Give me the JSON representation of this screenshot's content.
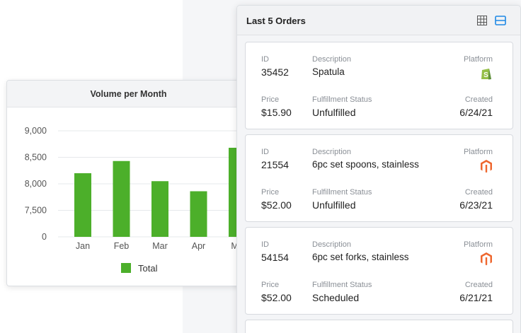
{
  "chart": {
    "title": "Volume per Month",
    "legend_label": "Total",
    "bar_color": "#4caf2a"
  },
  "chart_data": {
    "type": "bar",
    "title": "Volume per Month",
    "categories": [
      "Jan",
      "Feb",
      "Mar",
      "Apr",
      "Ma"
    ],
    "series": [
      {
        "name": "Total",
        "values": [
          8200,
          8430,
          8050,
          7860,
          8680
        ]
      }
    ],
    "yticks": [
      "9,000",
      "8,500",
      "8,000",
      "7,500",
      "0"
    ],
    "ylim": [
      7000,
      9000
    ],
    "legend_position": "bottom",
    "grid": true
  },
  "orders": {
    "title": "Last 5 Orders",
    "labels": {
      "id": "ID",
      "description": "Description",
      "platform": "Platform",
      "price": "Price",
      "fulfillment": "Fulfillment Status",
      "created": "Created"
    },
    "items": [
      {
        "id": "35452",
        "description": "Spatula",
        "platform_icon": "shopify-icon",
        "price": "$15.90",
        "fulfillment": "Unfulfilled",
        "created": "6/24/21"
      },
      {
        "id": "21554",
        "description": "6pc set spoons, stainless",
        "platform_icon": "magento-icon",
        "price": "$52.00",
        "fulfillment": "Unfulfilled",
        "created": "6/23/21"
      },
      {
        "id": "54154",
        "description": "6pc set forks, stainless",
        "platform_icon": "magento-icon",
        "price": "$52.00",
        "fulfillment": "Scheduled",
        "created": "6/21/21"
      }
    ]
  },
  "colors": {
    "shopify": "#95bf47",
    "magento": "#ee672f",
    "accent_blue": "#1e88e5"
  }
}
